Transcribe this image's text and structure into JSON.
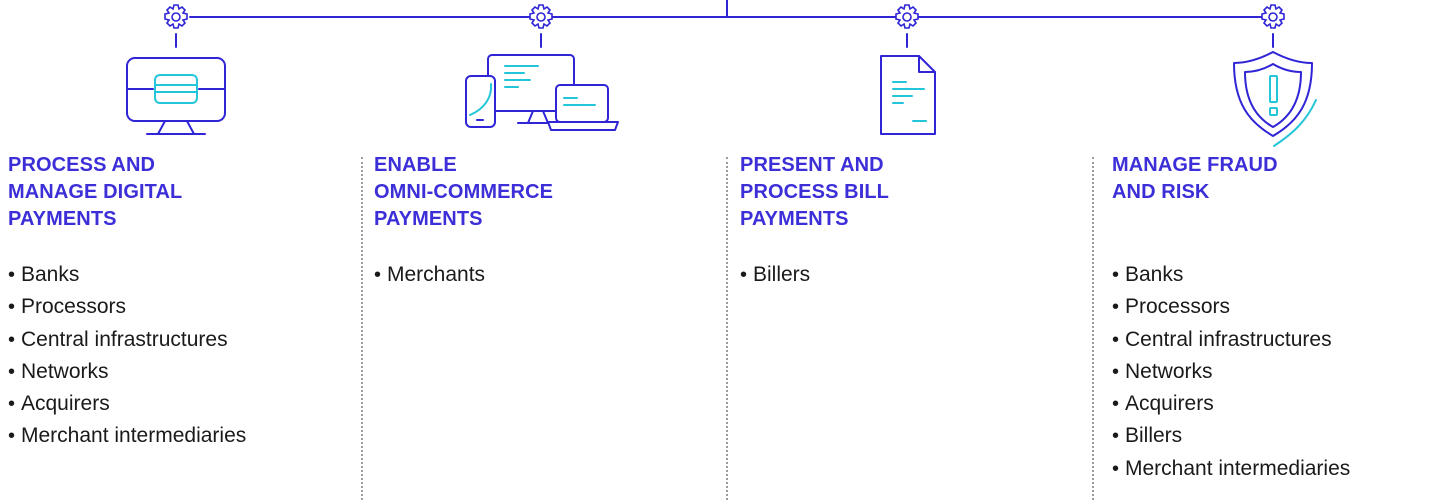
{
  "columns": [
    {
      "icon": "payment-monitor-icon",
      "heading_lines": [
        "PROCESS AND",
        "MANAGE DIGITAL",
        "PAYMENTS"
      ],
      "items": [
        "Banks",
        "Processors",
        "Central infrastructures",
        "Networks",
        "Acquirers",
        "Merchant intermediaries"
      ]
    },
    {
      "icon": "multi-device-icon",
      "heading_lines": [
        "ENABLE",
        "OMNI-COMMERCE",
        "PAYMENTS"
      ],
      "items": [
        "Merchants"
      ]
    },
    {
      "icon": "bill-document-icon",
      "heading_lines": [
        "PRESENT AND",
        "PROCESS BILL",
        "PAYMENTS"
      ],
      "items": [
        "Billers"
      ]
    },
    {
      "icon": "fraud-shield-icon",
      "heading_lines": [
        "MANAGE FRAUD",
        "AND RISK"
      ],
      "items": [
        "Banks",
        "Processors",
        "Central infrastructures",
        "Networks",
        "Acquirers",
        "Billers",
        "Merchant intermediaries"
      ]
    }
  ],
  "colors": {
    "heading": "#3c2fd8",
    "icon_stroke": "#2f24d6",
    "icon_accent": "#22c6d8",
    "text": "#1a1a1a",
    "divider": "#9b9b9b"
  },
  "bullet": "•"
}
